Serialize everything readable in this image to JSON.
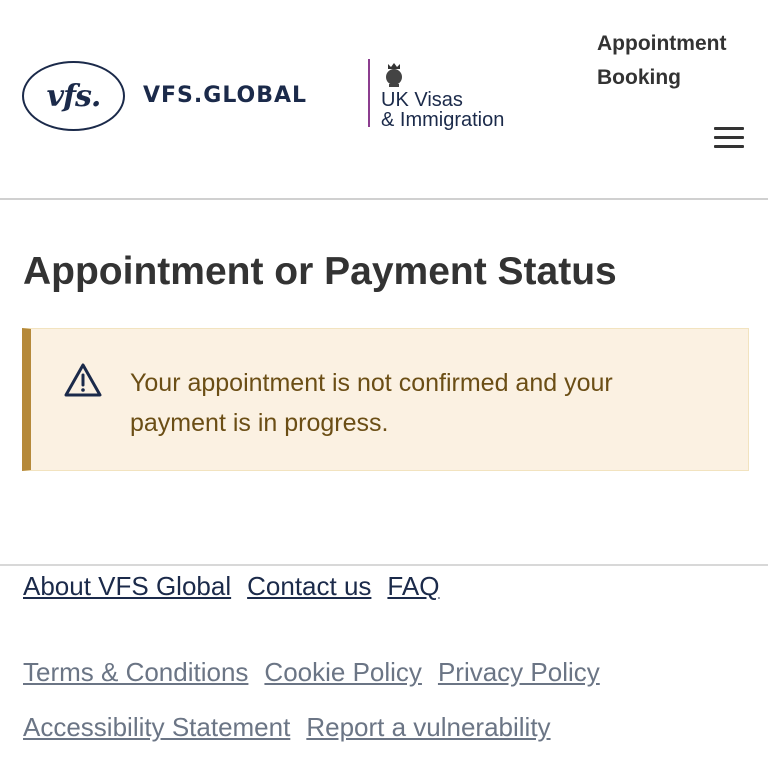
{
  "header": {
    "vfs_logo_text": "vfs.",
    "vfs_brand": "VFS.GLOBAL",
    "ukvi_line1": "UK Visas",
    "ukvi_line2": "& Immigration",
    "booking_title": "Appointment Booking",
    "menu_icon": "hamburger-menu-icon"
  },
  "main": {
    "title": "Appointment or Payment Status",
    "alert": {
      "icon": "warning-triangle-icon",
      "message": "Your appointment is not confirmed and your payment is in progress."
    }
  },
  "footer": {
    "primary_links": [
      "About VFS Global",
      "Contact us",
      "FAQ"
    ],
    "secondary_links_row1": [
      "Terms & Conditions",
      "Cookie Policy",
      "Privacy Policy"
    ],
    "secondary_links_row2": [
      "Accessibility Statement",
      "Report a vulnerability"
    ]
  },
  "colors": {
    "brand_navy": "#1b2a4a",
    "ukvi_purple": "#8c3d8f",
    "alert_bg": "#fbf1e2",
    "alert_border": "#b5893a",
    "alert_text": "#6b4e15"
  }
}
